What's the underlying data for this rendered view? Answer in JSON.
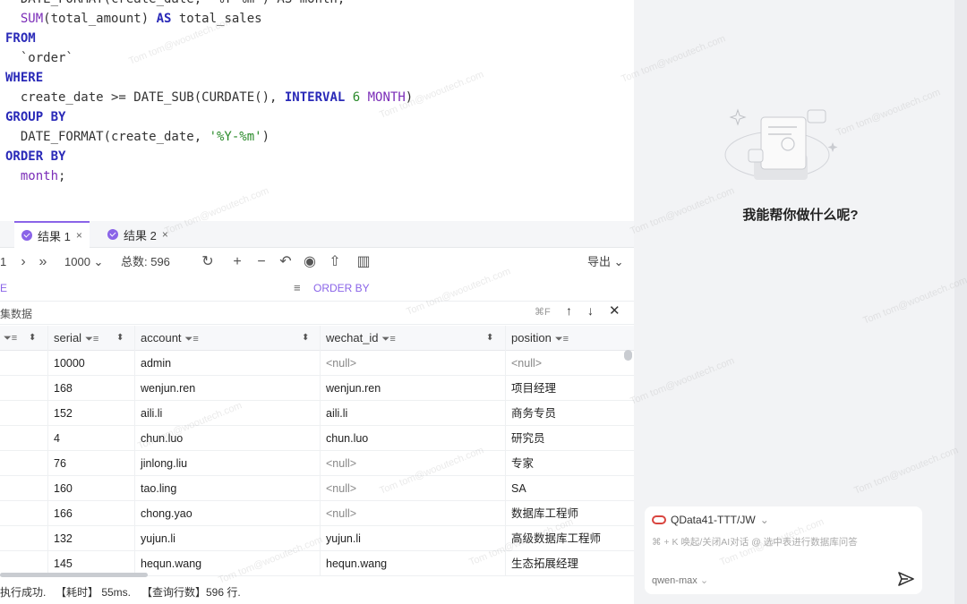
{
  "editor": {
    "lines": [
      [
        {
          "t": "  DATE_FORMAT(create_date, '%Y-%m') AS month,",
          "c": "plain"
        }
      ],
      [
        {
          "t": "  ",
          "c": "plain"
        },
        {
          "t": "SUM",
          "c": "fn"
        },
        {
          "t": "(total_amount) ",
          "c": "plain"
        },
        {
          "t": "AS",
          "c": "kw"
        },
        {
          "t": " total_sales",
          "c": "plain"
        }
      ],
      [
        {
          "t": "FROM",
          "c": "kw"
        }
      ],
      [
        {
          "t": "  ",
          "c": "plain"
        },
        {
          "t": "`order`",
          "c": "plain"
        }
      ],
      [
        {
          "t": "WHERE",
          "c": "kw"
        }
      ],
      [
        {
          "t": "  create_date >= DATE_SUB(CURDATE(), ",
          "c": "plain"
        },
        {
          "t": "INTERVAL",
          "c": "kw"
        },
        {
          "t": " ",
          "c": "plain"
        },
        {
          "t": "6",
          "c": "num"
        },
        {
          "t": " ",
          "c": "plain"
        },
        {
          "t": "MONTH",
          "c": "fn"
        },
        {
          "t": ")",
          "c": "plain"
        }
      ],
      [
        {
          "t": "GROUP BY",
          "c": "kw"
        }
      ],
      [
        {
          "t": "  DATE_FORMAT(create_date, ",
          "c": "plain"
        },
        {
          "t": "'%Y-%m'",
          "c": "str"
        },
        {
          "t": ")",
          "c": "plain"
        }
      ],
      [
        {
          "t": "ORDER BY",
          "c": "kw"
        }
      ],
      [
        {
          "t": "  ",
          "c": "plain"
        },
        {
          "t": "month",
          "c": "fn"
        },
        {
          "t": ";",
          "c": "plain"
        }
      ]
    ]
  },
  "tabs": [
    {
      "label": "结果 1",
      "close": "×"
    },
    {
      "label": "结果 2",
      "close": "×"
    }
  ],
  "toolbar": {
    "page": "1",
    "page_size": "1000",
    "total": "总数: 596",
    "export": "导出"
  },
  "filter": {
    "where_fragment": "E",
    "order_by": "ORDER BY"
  },
  "search": {
    "label": "集数据",
    "shortcut": "⌘F"
  },
  "table": {
    "columns": [
      "serial",
      "account",
      "wechat_id",
      "position"
    ],
    "rows": [
      [
        "10000",
        "admin",
        "<null>",
        "<null>"
      ],
      [
        "168",
        "wenjun.ren",
        "wenjun.ren",
        "项目经理"
      ],
      [
        "152",
        "aili.li",
        "aili.li",
        "商务专员"
      ],
      [
        "4",
        "chun.luo",
        "chun.luo",
        "研究员"
      ],
      [
        "76",
        "jinlong.liu",
        "<null>",
        "专家"
      ],
      [
        "160",
        "tao.ling",
        "<null>",
        "SA"
      ],
      [
        "166",
        "chong.yao",
        "<null>",
        "数据库工程师"
      ],
      [
        "132",
        "yujun.li",
        "yujun.li",
        "高级数据库工程师"
      ],
      [
        "145",
        "hequn.wang",
        "hequn.wang",
        "生态拓展经理"
      ]
    ]
  },
  "status": {
    "result": "执行成功.",
    "time": "【耗时】 55ms.",
    "rows": "【查询行数】596 行."
  },
  "assistant": {
    "title": "我能帮你做什么呢?",
    "datasource": "QData41-TTT/JW",
    "hint": "⌘ + K 唤起/关闭AI对话 @ 选中表进行数据库问答",
    "model": "qwen-max"
  },
  "watermark": "Tom tom@wooutech.com",
  "colors": {
    "accent": "#8a64e8",
    "keyword": "#2a2ab8",
    "function": "#7b2db8",
    "string": "#2a8a2a",
    "datasource_icon": "#d9453f"
  }
}
